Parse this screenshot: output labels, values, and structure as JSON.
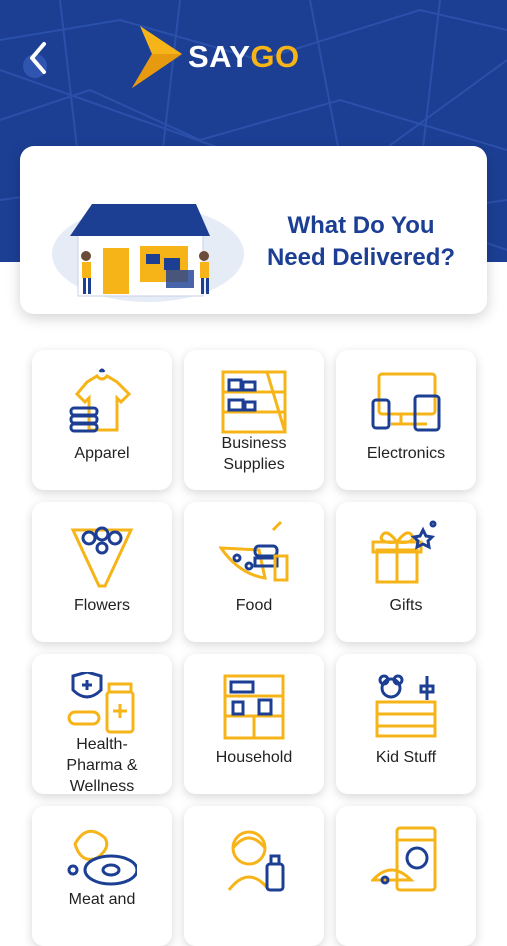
{
  "header": {
    "brand_say": "SAY",
    "brand_go": "GO"
  },
  "hero": {
    "title_line1": "What Do You",
    "title_line2": "Need Delivered?"
  },
  "categories": [
    {
      "label_lines": [
        "Apparel"
      ],
      "icon": "shirt-icon"
    },
    {
      "label_lines": [
        "Business",
        "Supplies"
      ],
      "icon": "shelves-icon"
    },
    {
      "label_lines": [
        "Electronics"
      ],
      "icon": "devices-icon"
    },
    {
      "label_lines": [
        "Flowers"
      ],
      "icon": "bouquet-icon"
    },
    {
      "label_lines": [
        "Food"
      ],
      "icon": "pizza-icon"
    },
    {
      "label_lines": [
        "Gifts"
      ],
      "icon": "gift-icon"
    },
    {
      "label_lines": [
        "Health-",
        "Pharma &",
        "Wellness"
      ],
      "icon": "medicine-icon"
    },
    {
      "label_lines": [
        "Household"
      ],
      "icon": "cabinet-icon"
    },
    {
      "label_lines": [
        "Kid Stuff"
      ],
      "icon": "toybox-icon"
    },
    {
      "label_lines": [
        "Meat and"
      ],
      "icon": "meat-icon"
    },
    {
      "label_lines": [],
      "icon": "cleaning-icon"
    },
    {
      "label_lines": [],
      "icon": "pet-icon"
    }
  ],
  "colors": {
    "brand_blue": "#1c3f94",
    "accent_yellow": "#f6b418"
  }
}
